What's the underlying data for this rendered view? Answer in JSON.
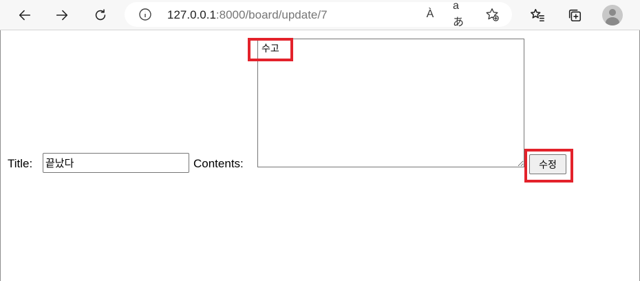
{
  "browser": {
    "url_host": "127.0.0.1",
    "url_rest": ":8000/board/update/7",
    "read_aloud_glyph": "À",
    "translate_glyph": "aあ"
  },
  "form": {
    "title_label": "Title:",
    "title_value": "끝났다",
    "contents_label": "Contents:",
    "contents_value": "수고",
    "submit_label": "수정"
  },
  "colors": {
    "highlight": "#e3222b"
  },
  "icons": [
    "back-icon",
    "forward-icon",
    "reload-icon",
    "info-icon",
    "read-aloud-icon",
    "translate-icon",
    "add-favorite-icon",
    "favorites-icon",
    "collections-icon",
    "profile-icon"
  ]
}
